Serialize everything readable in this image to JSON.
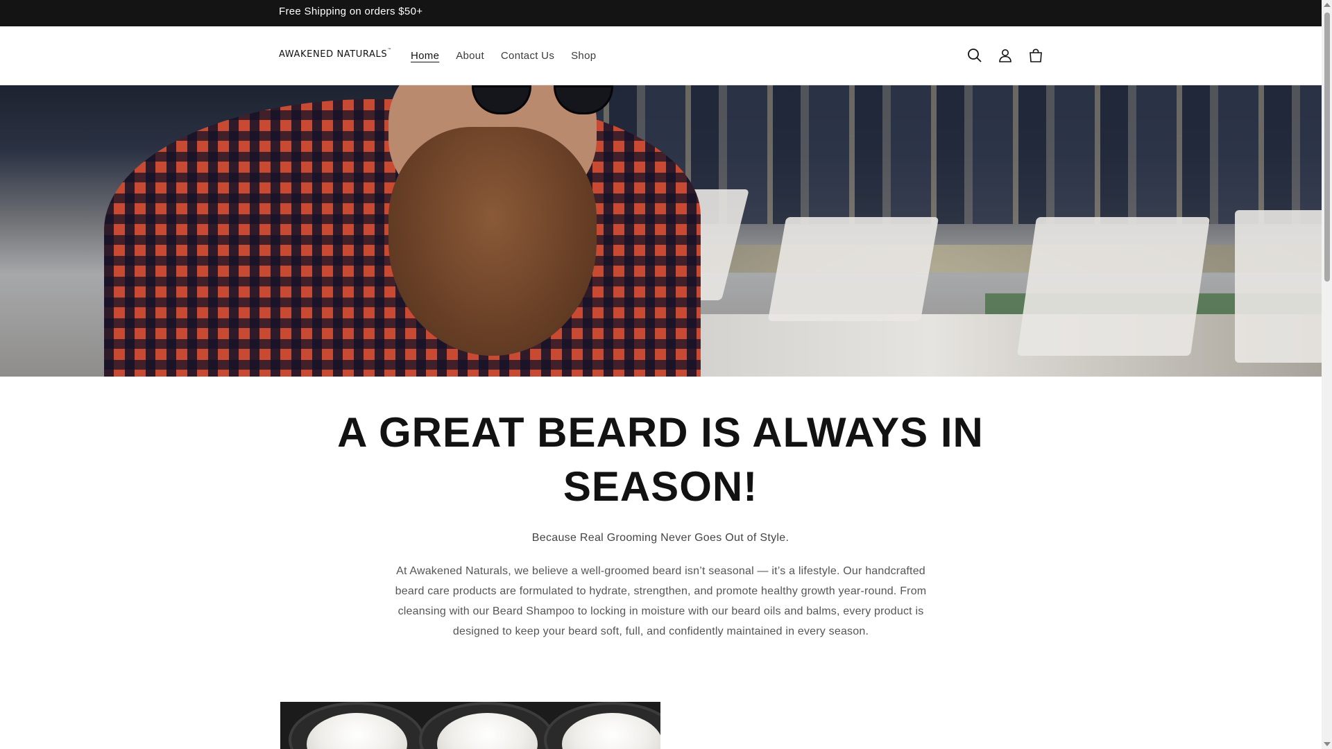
{
  "announcement": {
    "text": "Free Shipping on orders $50+"
  },
  "header": {
    "logo": "AWAKENED NATURALS",
    "logo_mark": "™",
    "nav": [
      {
        "label": "Home",
        "active": true
      },
      {
        "label": "About",
        "active": false
      },
      {
        "label": "Contact Us",
        "active": false
      },
      {
        "label": "Shop",
        "active": false
      }
    ],
    "icons": [
      "search-icon",
      "account-icon",
      "cart-icon"
    ]
  },
  "hero": {
    "image": "bearded man in red plaid shirt wearing sunglasses"
  },
  "content": {
    "headline": "A GREAT BEARD IS ALWAYS IN SEASON!",
    "subheading": "Because Real Grooming Never Goes Out of Style.",
    "body": "At Awakened Naturals, we believe a well-groomed beard isn’t seasonal — it’s a lifestyle. Our handcrafted beard care products are formulated to hydrate, strengthen, and promote healthy growth year-round. From cleansing with our Beard Shampoo to locking in moisture with our beard oils and balms, every product is designed to keep your beard soft, full, and confidently maintained in every season."
  },
  "colors": {
    "announcement_bg": "#141414",
    "text": "#121212",
    "muted_text": "#555555",
    "background": "#ffffff"
  }
}
